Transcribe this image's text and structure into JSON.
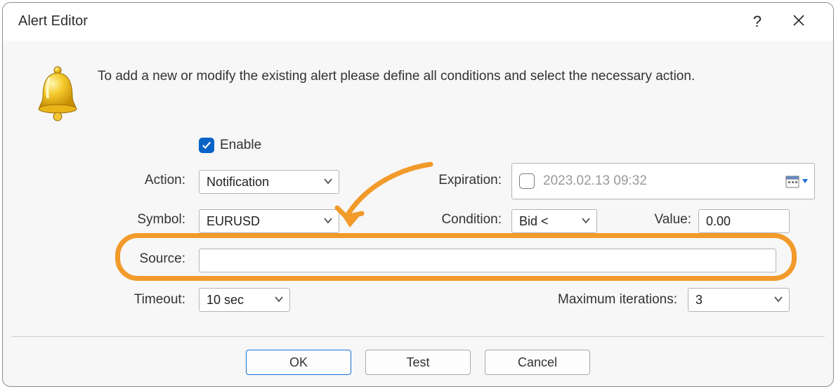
{
  "window": {
    "title": "Alert Editor",
    "help_glyph": "?",
    "intro": "To add a new or modify the existing alert please define all conditions and select the necessary action."
  },
  "form": {
    "enable": {
      "label": "Enable",
      "checked": true
    },
    "action": {
      "label": "Action:",
      "value": "Notification"
    },
    "symbol": {
      "label": "Symbol:",
      "value": "EURUSD"
    },
    "source": {
      "label": "Source:",
      "value": ""
    },
    "timeout": {
      "label": "Timeout:",
      "value": "10 sec"
    },
    "expiration": {
      "label": "Expiration:",
      "checked": false,
      "value": "2023.02.13 09:32"
    },
    "condition": {
      "label": "Condition:",
      "value": "Bid <"
    },
    "value": {
      "label": "Value:",
      "value": "0.00"
    },
    "maxiter": {
      "label": "Maximum iterations:",
      "value": "3"
    }
  },
  "buttons": {
    "ok": "OK",
    "test": "Test",
    "cancel": "Cancel"
  },
  "icons": {
    "bell": "bell-icon",
    "chevron_down": "chevron-down-icon",
    "calendar": "calendar-icon",
    "close": "close-icon",
    "help": "help-icon"
  }
}
